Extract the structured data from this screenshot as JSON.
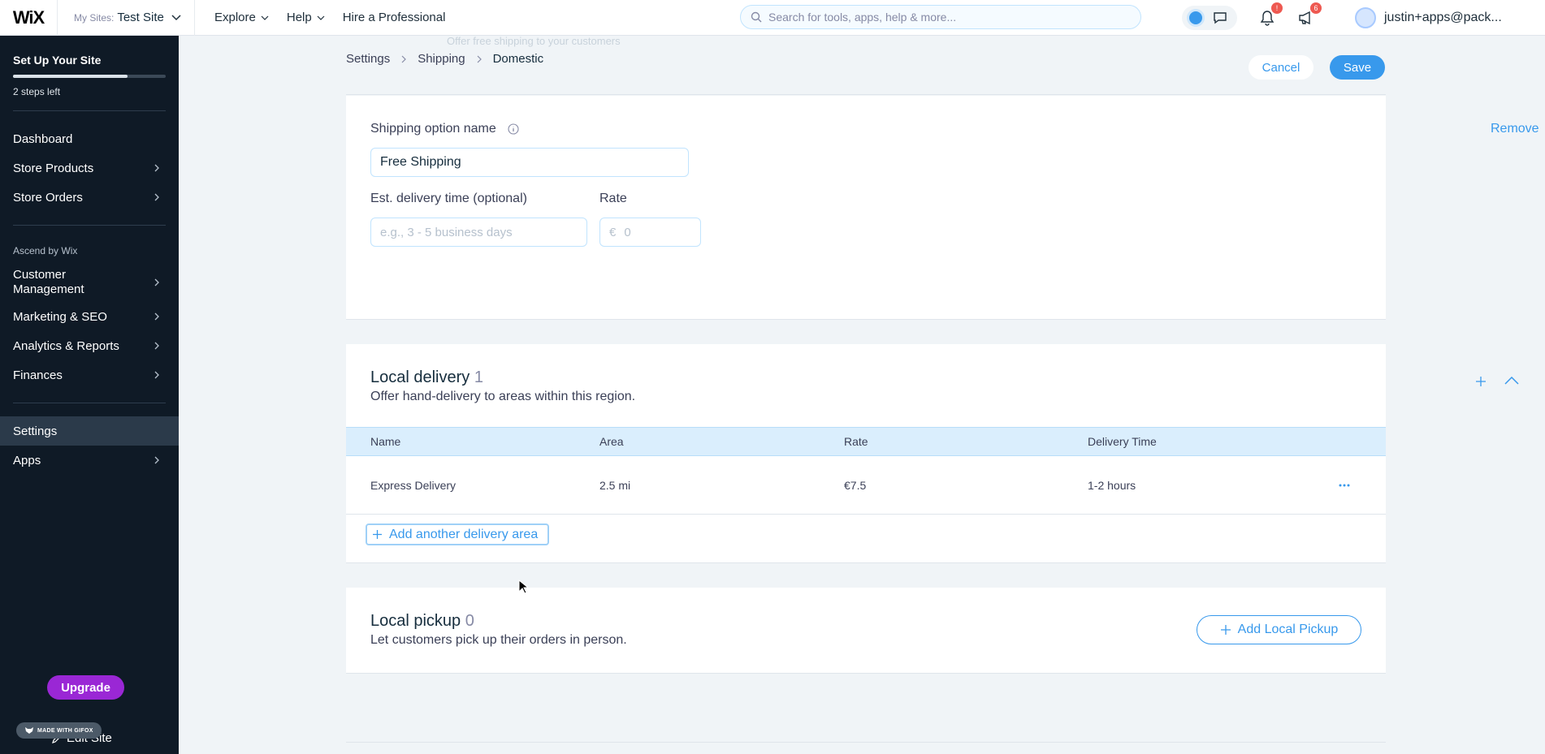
{
  "header": {
    "logo": "WiX",
    "mysites_label": "My Sites:",
    "site_name": "Test Site",
    "nav": [
      "Explore",
      "Help",
      "Hire a Professional"
    ],
    "search_placeholder": "Search for tools, apps, help & more...",
    "notification_badge": "!",
    "updates_badge": "6",
    "user_email": "justin+apps@pack..."
  },
  "sidebar": {
    "setup_title": "Set Up Your Site",
    "setup_progress": 0.75,
    "steps_left": "2 steps left",
    "items_top": [
      {
        "label": "Dashboard",
        "has_arrow": false
      },
      {
        "label": "Store Products",
        "has_arrow": true
      },
      {
        "label": "Store Orders",
        "has_arrow": true
      }
    ],
    "section_label": "Ascend by Wix",
    "items_ascend": [
      {
        "label": "Customer Management",
        "has_arrow": true
      },
      {
        "label": "Marketing & SEO",
        "has_arrow": true
      },
      {
        "label": "Analytics & Reports",
        "has_arrow": true
      },
      {
        "label": "Finances",
        "has_arrow": true
      }
    ],
    "items_bottom": [
      {
        "label": "Settings",
        "has_arrow": false,
        "active": true
      },
      {
        "label": "Apps",
        "has_arrow": true
      }
    ],
    "upgrade_label": "Upgrade",
    "gifox_label": "MADE WITH GIFOX",
    "edit_site_label": "Edit Site"
  },
  "content": {
    "ghost_text": "Offer free shipping to your customers",
    "breadcrumbs": [
      "Settings",
      "Shipping",
      "Domestic"
    ],
    "cancel_label": "Cancel",
    "save_label": "Save",
    "shipping_option": {
      "name_label": "Shipping option name",
      "remove_label": "Remove",
      "name_value": "Free Shipping",
      "delivery_label": "Est. delivery time (optional)",
      "delivery_placeholder": "e.g., 3 - 5 business days",
      "rate_label": "Rate",
      "rate_currency": "€",
      "rate_placeholder": "0"
    },
    "local_delivery": {
      "title": "Local delivery",
      "count": "1",
      "subtitle": "Offer hand-delivery to areas within this region.",
      "columns": [
        "Name",
        "Area",
        "Rate",
        "Delivery Time"
      ],
      "rows": [
        {
          "name": "Express Delivery",
          "area": "2.5 mi",
          "rate": "€7.5",
          "time": "1-2 hours"
        }
      ],
      "add_area_label": "Add another delivery area"
    },
    "local_pickup": {
      "title": "Local pickup",
      "count": "0",
      "subtitle": "Let customers pick up their orders in person.",
      "add_label": "Add Local Pickup"
    }
  },
  "colors": {
    "accent": "#3899ec",
    "sidebar_bg": "#0f1a26",
    "upgrade": "#9a27d5",
    "table_header": "#daeefd"
  }
}
